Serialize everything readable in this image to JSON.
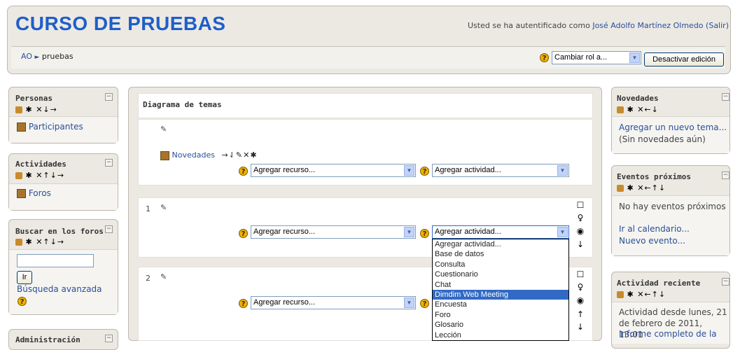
{
  "header": {
    "title": "CURSO DE PRUEBAS",
    "login_prefix": "Usted se ha autentificado como ",
    "user_name": "José Adolfo Martínez Olmedo",
    "logout": "(Salir)",
    "breadcrumb_home": "AO",
    "breadcrumb_sep": "►",
    "breadcrumb_current": "pruebas",
    "role_select": "Cambiar rol a...",
    "edit_button": "Desactivar edición"
  },
  "left_blocks": {
    "personas": {
      "title": "Personas",
      "icons": "✱ ✕↓→",
      "link": "Participantes"
    },
    "actividades": {
      "title": "Actividades",
      "icons": "✱ ✕↑↓→",
      "link": "Foros"
    },
    "buscar": {
      "title": "Buscar en los foros",
      "icons": "✱ ✕↑↓→",
      "input_value": "",
      "go_button": "Ir",
      "advanced": "Búsqueda avanzada"
    },
    "admin": {
      "title": "Administración"
    }
  },
  "main": {
    "title": "Diagrama de temas",
    "section0": {
      "forum_link": "Novedades",
      "forum_icons": "→⇃✎✕✱",
      "resource": "Agregar recurso...",
      "activity": "Agregar actividad..."
    },
    "section1": {
      "number": "1",
      "resource": "Agregar recurso...",
      "activity": "Agregar actividad..."
    },
    "section2": {
      "number": "2",
      "resource": "Agregar recurso..."
    }
  },
  "activity_dropdown": {
    "items": [
      "Agregar actividad...",
      "Base de datos",
      "Consulta",
      "Cuestionario",
      "Chat",
      "Dimdim Web Meeting",
      "Encuesta",
      "Foro",
      "Glosario",
      "Lección"
    ],
    "highlighted": "Dimdim Web Meeting"
  },
  "right_blocks": {
    "novedades": {
      "title": "Novedades",
      "icons": "✱ ✕←↓",
      "link": "Agregar un nuevo tema...",
      "note": "(Sin novedades aún)"
    },
    "eventos": {
      "title": "Eventos próximos",
      "icons": "✱ ✕←↑↓",
      "note": "No hay eventos próximos",
      "link1": "Ir al calendario...",
      "link2": "Nuevo evento..."
    },
    "actividad": {
      "title": "Actividad reciente",
      "icons": "✱ ✕←↑↓",
      "note": "Actividad desde lunes, 21 de febrero de 2011, 13:01",
      "link": "Informe completo de la"
    }
  },
  "colors": {
    "title_blue": "#1e5ec8",
    "link_blue": "#2a4f9a",
    "block_bg": "#ece9e3",
    "highlight": "#316ac5"
  }
}
